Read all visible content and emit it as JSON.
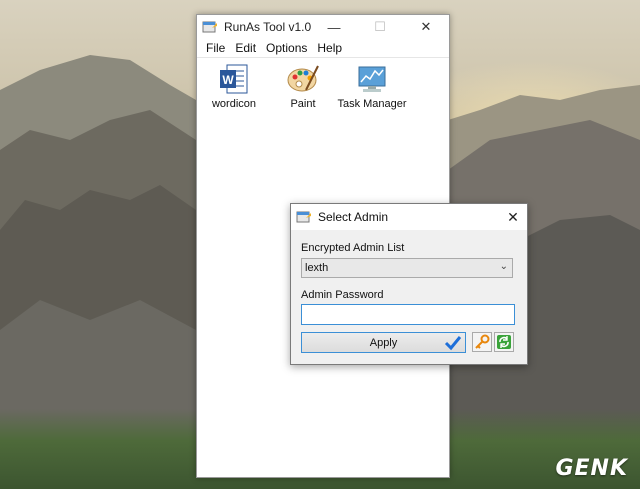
{
  "main_window": {
    "title": "RunAs Tool v1.0",
    "menu": [
      "File",
      "Edit",
      "Options",
      "Help"
    ],
    "apps": [
      {
        "label": "wordicon",
        "icon": "word-icon"
      },
      {
        "label": "Paint",
        "icon": "paint-palette-icon"
      },
      {
        "label": "Task Manager",
        "icon": "task-manager-icon"
      }
    ]
  },
  "dialog": {
    "title": "Select Admin",
    "list_label": "Encrypted Admin List",
    "list_value": "lexth",
    "password_label": "Admin Password",
    "password_value": "",
    "apply_label": "Apply"
  },
  "watermark": "GENK",
  "colors": {
    "focus_border": "#3b8fd6",
    "word_blue": "#2b579a",
    "check_blue": "#1e6fd9"
  }
}
